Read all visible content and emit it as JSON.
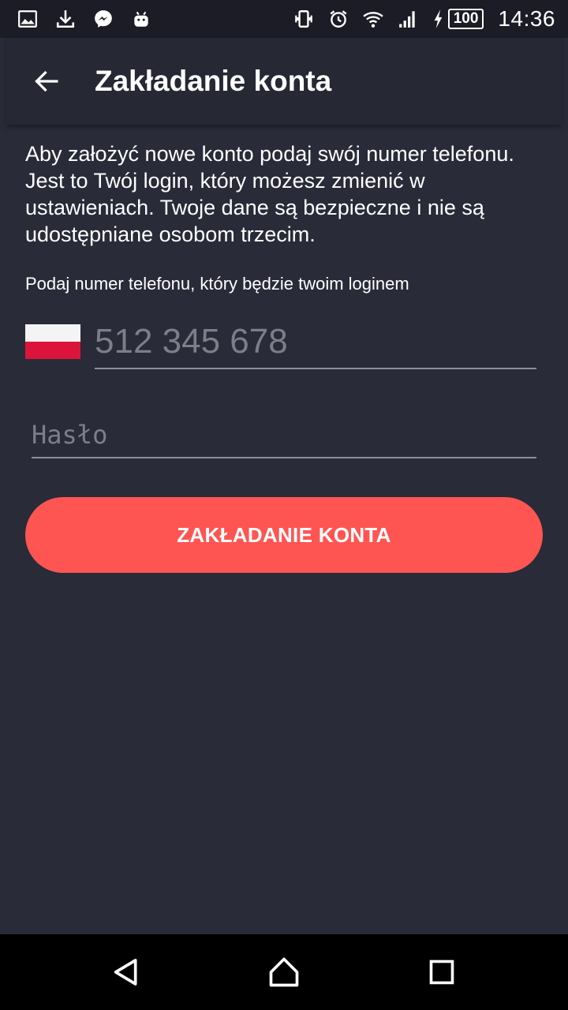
{
  "status_bar": {
    "time": "14:36",
    "battery": "100",
    "icons_left": [
      "image-icon",
      "download-icon",
      "messenger-icon",
      "android-icon"
    ],
    "icons_right": [
      "vibrate-icon",
      "alarm-icon",
      "wifi-icon",
      "signal-icon",
      "charging-icon"
    ]
  },
  "app_bar": {
    "title": "Zakładanie konta",
    "back_icon": "arrow-back-icon"
  },
  "main": {
    "description": "Aby założyć nowe konto podaj swój numer telefonu. Jest to Twój login, który możesz zmienić w ustawieniach. Twoje dane są bezpieczne i nie są udostępniane osobom trzecim.",
    "phone_label": "Podaj numer telefonu, który będzie twoim loginem",
    "phone_placeholder": "512 345 678",
    "phone_value": "",
    "password_placeholder": "Hasło",
    "password_value": "",
    "submit_label": "ZAKŁADANIE KONTA",
    "country_flag": "poland-flag-icon"
  },
  "colors": {
    "background": "#292b38",
    "accent": "#fe5553"
  },
  "nav_bar": {
    "buttons": [
      "back-triangle-icon",
      "home-icon",
      "recents-icon"
    ]
  }
}
